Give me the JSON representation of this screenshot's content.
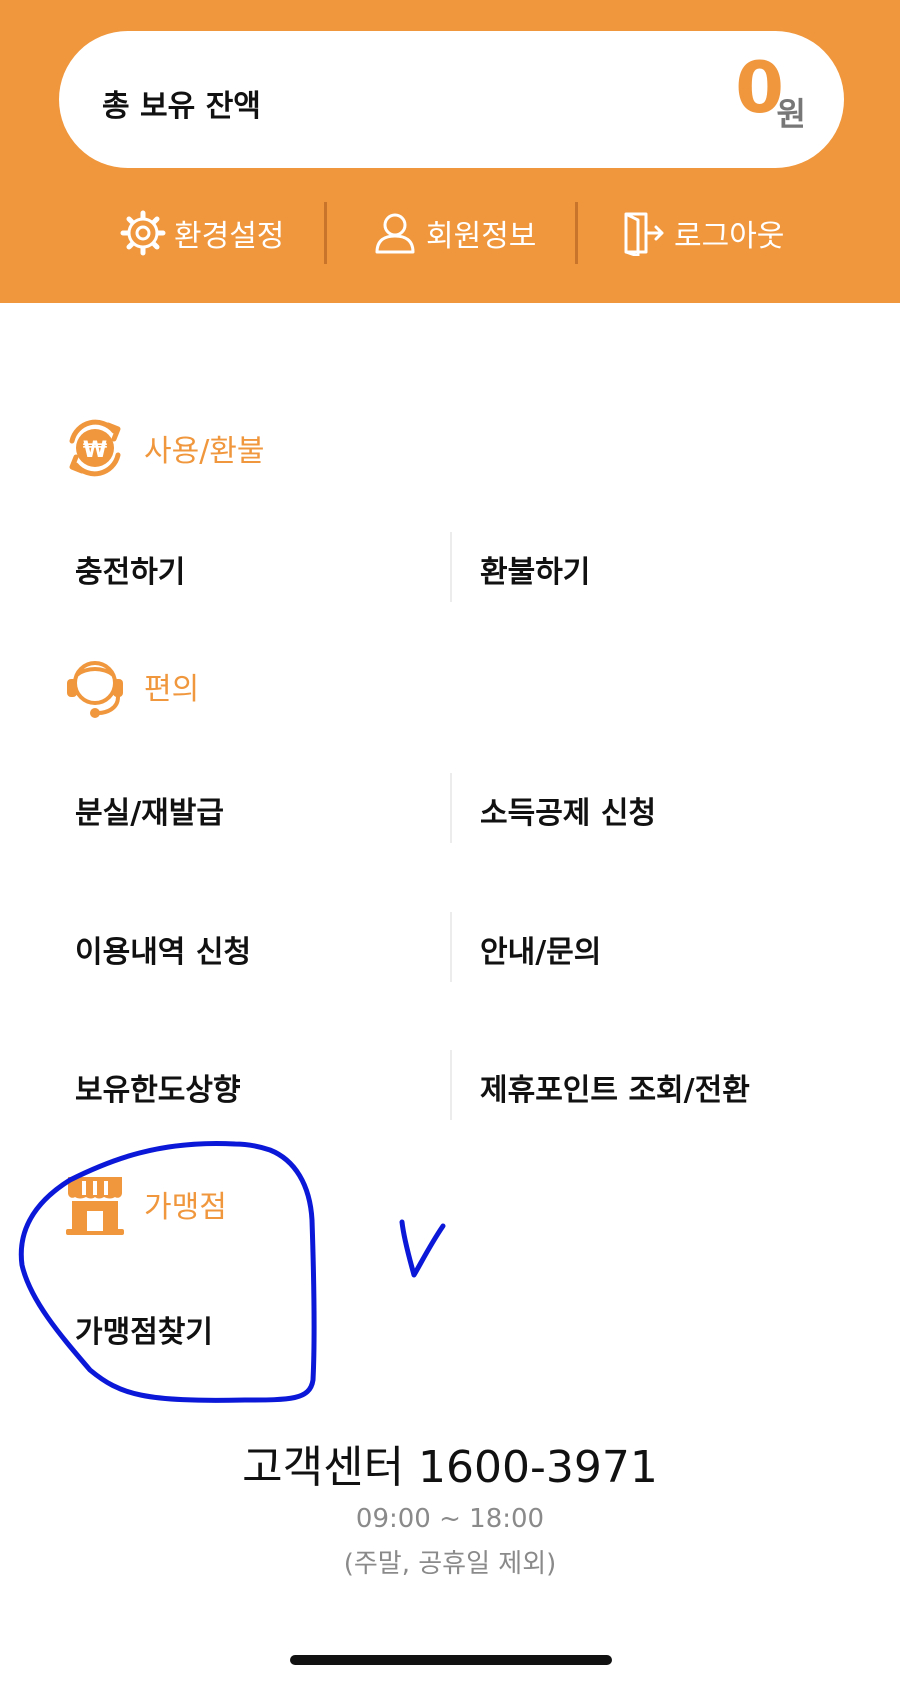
{
  "header": {
    "balance_label": "총 보유 잔액",
    "balance_amount": "0",
    "balance_unit": "원",
    "menu": [
      {
        "label": "환경설정",
        "icon": "gear-icon"
      },
      {
        "label": "회원정보",
        "icon": "user-icon"
      },
      {
        "label": "로그아웃",
        "icon": "logout-icon"
      }
    ]
  },
  "sections": [
    {
      "title": "사용/환불",
      "icon": "won-refresh-icon",
      "items": [
        "충전하기",
        "환불하기"
      ]
    },
    {
      "title": "편의",
      "icon": "headset-icon",
      "items": [
        "분실/재발급",
        "소득공제 신청",
        "이용내역 신청",
        "안내/문의",
        "보유한도상향",
        "제휴포인트 조회/전환"
      ]
    },
    {
      "title": "가맹점",
      "icon": "store-icon",
      "items": [
        "가맹점찾기"
      ]
    }
  ],
  "annotation": {
    "mark": "v"
  },
  "footer": {
    "title": "고객센터 1600-3971",
    "hours": "09:00 ~ 18:00",
    "note": "(주말, 공휴일 제외)"
  },
  "colors": {
    "accent": "#f0973d",
    "annotation_ink": "#0b18d8"
  }
}
